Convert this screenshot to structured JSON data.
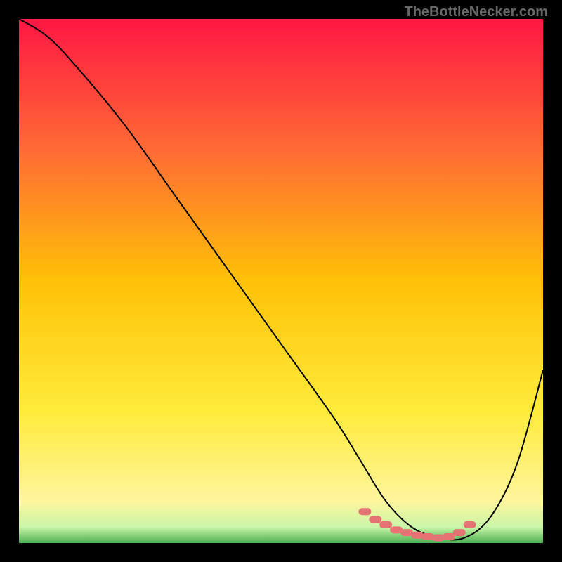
{
  "watermark": "TheBottleNecker.com",
  "chart_data": {
    "type": "line",
    "title": "",
    "xlabel": "",
    "ylabel": "",
    "xlim": [
      0,
      100
    ],
    "ylim": [
      0,
      100
    ],
    "gradient_stops": [
      {
        "offset": 0,
        "color": "#ff1744"
      },
      {
        "offset": 25,
        "color": "#ff6b35"
      },
      {
        "offset": 50,
        "color": "#ffc107"
      },
      {
        "offset": 75,
        "color": "#ffeb3b"
      },
      {
        "offset": 92,
        "color": "#fff59d"
      },
      {
        "offset": 97,
        "color": "#c8f5a8"
      },
      {
        "offset": 100,
        "color": "#4caf50"
      }
    ],
    "series": [
      {
        "name": "curve",
        "color": "#000000",
        "x": [
          0,
          5,
          10,
          20,
          30,
          40,
          50,
          60,
          65,
          70,
          75,
          80,
          85,
          90,
          95,
          100
        ],
        "y": [
          100,
          97,
          92,
          80,
          66,
          52,
          38,
          24,
          16,
          8,
          3,
          1,
          1,
          5,
          15,
          33
        ]
      }
    ],
    "markers": {
      "name": "highlight",
      "color": "#e57373",
      "x": [
        66,
        68,
        70,
        72,
        74,
        76,
        78,
        80,
        82,
        84,
        86
      ],
      "y": [
        6,
        4.5,
        3.5,
        2.5,
        2,
        1.5,
        1.2,
        1,
        1.2,
        2,
        3.5
      ]
    }
  }
}
